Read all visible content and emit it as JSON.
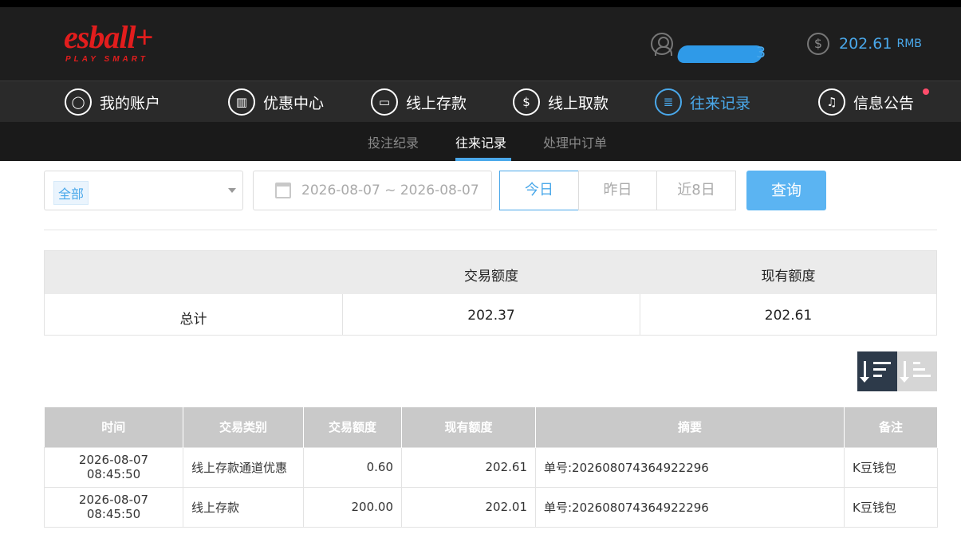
{
  "brand": {
    "logo_text": "esball+",
    "tagline": "PLAY SMART",
    "color": "#e21d1d"
  },
  "header": {
    "username_visible": "3",
    "balance": "202.61",
    "currency": "RMB",
    "accent": "#4aa8ea"
  },
  "nav": [
    {
      "label": "我的账户",
      "icon": "user-icon"
    },
    {
      "label": "优惠中心",
      "icon": "gift-icon"
    },
    {
      "label": "线上存款",
      "icon": "deposit-icon"
    },
    {
      "label": "线上取款",
      "icon": "withdraw-icon"
    },
    {
      "label": "往来记录",
      "icon": "records-icon",
      "active": true
    },
    {
      "label": "信息公告",
      "icon": "bell-icon",
      "badge_dot": true
    }
  ],
  "subnav": [
    {
      "label": "投注纪录"
    },
    {
      "label": "往来记录",
      "active": true
    },
    {
      "label": "处理中订单"
    }
  ],
  "filters": {
    "type_selected": "全部",
    "date_range": "2026-08-07 ~ 2026-08-07",
    "quick": [
      "今日",
      "昨日",
      "近8日"
    ],
    "quick_active": "今日",
    "search_label": "查询"
  },
  "summary": {
    "headers": [
      "",
      "交易额度",
      "现有额度"
    ],
    "row": [
      "总计",
      "202.37",
      "202.61"
    ]
  },
  "table": {
    "columns": [
      "时间",
      "交易类别",
      "交易额度",
      "现有额度",
      "摘要",
      "备注"
    ],
    "rows": [
      [
        "2026-08-07 08:45:50",
        "线上存款通道优惠",
        "0.60",
        "202.61",
        "单号:202608074364922296",
        "K豆钱包"
      ],
      [
        "2026-08-07 08:45:50",
        "线上存款",
        "200.00",
        "202.01",
        "单号:202608074364922296",
        "K豆钱包"
      ]
    ]
  }
}
